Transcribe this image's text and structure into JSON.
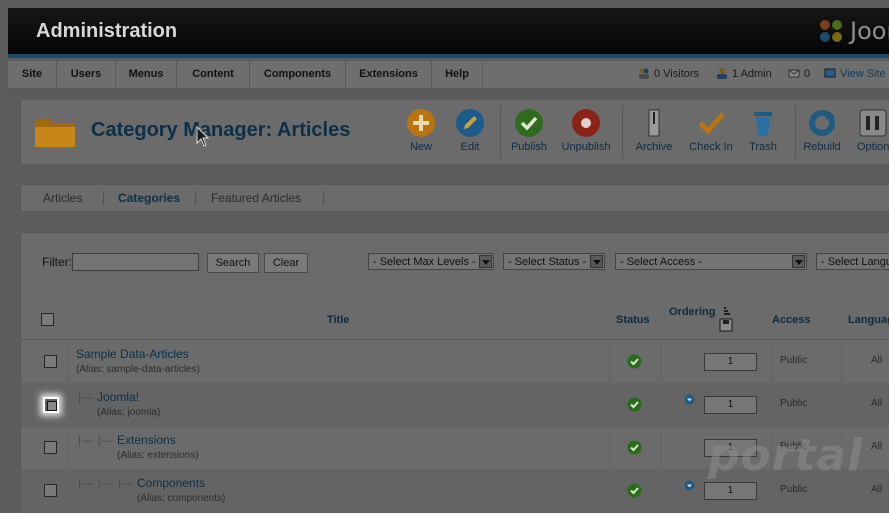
{
  "header": {
    "title": "Administration",
    "logo_text": "Joomla"
  },
  "menu": {
    "items": [
      "Site",
      "Users",
      "Menus",
      "Content",
      "Components",
      "Extensions",
      "Help"
    ],
    "status": {
      "visitors": "0 Visitors",
      "admins": "1 Admin",
      "messages": "0",
      "view_site": "View Site"
    }
  },
  "toolbar": {
    "page_title": "Category Manager: Articles",
    "buttons": [
      "New",
      "Edit",
      "Publish",
      "Unpublish",
      "Archive",
      "Check In",
      "Trash",
      "Rebuild",
      "Options"
    ]
  },
  "subnav": [
    "Articles",
    "Categories",
    "Featured Articles"
  ],
  "filter": {
    "label": "Filter:",
    "value": "",
    "search_label": "Search",
    "clear_label": "Clear",
    "selects": [
      "- Select Max Levels -",
      "- Select Status -",
      "- Select Access -",
      "- Select Language -"
    ]
  },
  "table": {
    "headers": {
      "title": "Title",
      "status": "Status",
      "ordering": "Ordering",
      "access": "Access",
      "language": "Language"
    },
    "rows": [
      {
        "title": "Sample Data-Articles",
        "alias": "(Alias: sample-data-articles)",
        "order": "1",
        "access": "Public",
        "language": "All"
      },
      {
        "title": "Joomla!",
        "alias": "(Alias: joomla)",
        "order": "1",
        "access": "Public",
        "language": "All"
      },
      {
        "title": "Extensions",
        "alias": "(Alias: extensions)",
        "order": "1",
        "access": "Public",
        "language": "All"
      },
      {
        "title": "Components",
        "alias": "(Alias: components)",
        "order": "1",
        "access": "Public",
        "language": "All"
      }
    ]
  },
  "watermark": "portal",
  "colors": {
    "accent": "#0c2f4a",
    "publish": "#2f7a1f",
    "unpublish": "#9b2a1a",
    "new": "#c87b10"
  }
}
